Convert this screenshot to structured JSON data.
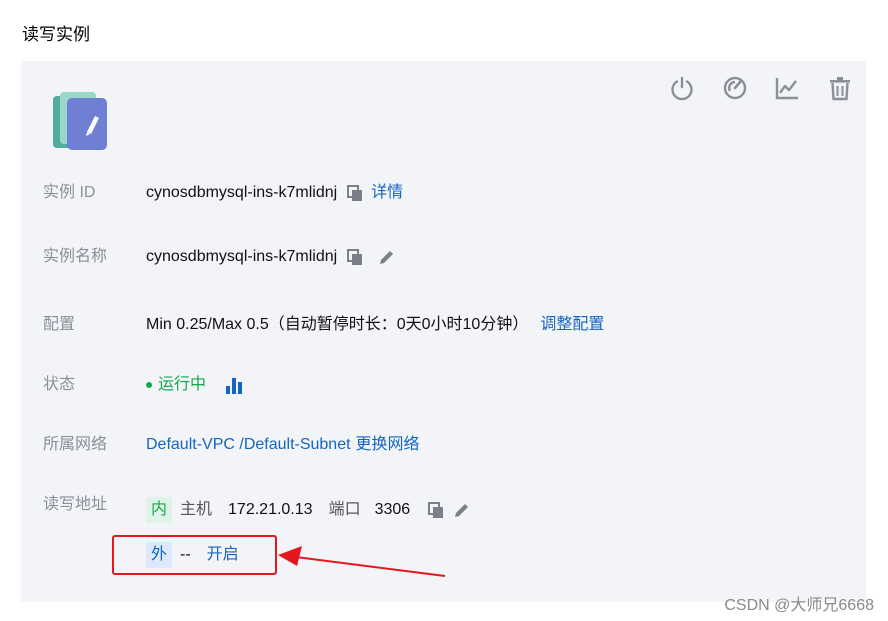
{
  "section": {
    "title": "读写实例"
  },
  "toolbar": {
    "icons": [
      "power-icon",
      "gauge-icon",
      "line-chart-icon",
      "trash-icon"
    ]
  },
  "rows": {
    "instance_id": {
      "label": "实例 ID",
      "value": "cynosdbmysql-ins-k7mlidnj",
      "link": "详情"
    },
    "instance_name": {
      "label": "实例名称",
      "value": "cynosdbmysql-ins-k7mlidnj"
    },
    "config": {
      "label": "配置",
      "value": "Min 0.25/Max 0.5（自动暂停时长：0天0小时10分钟）",
      "link": "调整配置"
    },
    "status": {
      "label": "状态",
      "value": "运行中"
    },
    "network": {
      "label": "所属网络",
      "vpc": "Default-VPC",
      "sep": " /",
      "subnet": "Default-Subnet",
      "link": "更换网络"
    },
    "rw_address": {
      "label": "读写地址",
      "internal": {
        "tag": "内",
        "host_label": "主机",
        "host": "172.21.0.13",
        "port_label": "端口",
        "port": "3306"
      },
      "external": {
        "tag": "外",
        "value": "--",
        "link": "开启"
      }
    }
  },
  "watermark": "CSDN @大师兄6668",
  "colors": {
    "link": "#1565c0",
    "running": "#12a84e",
    "highlight": "#e5171e"
  }
}
